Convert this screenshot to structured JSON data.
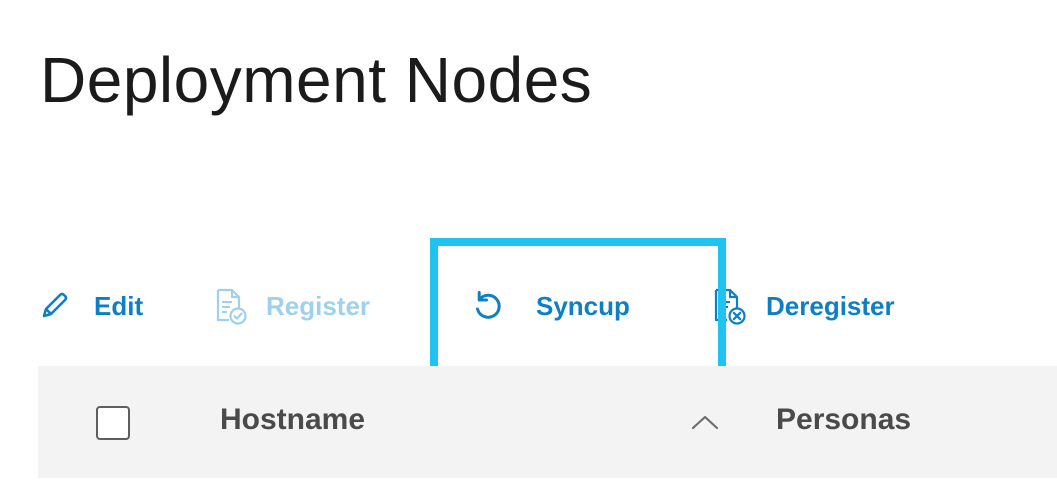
{
  "page": {
    "title": "Deployment Nodes"
  },
  "toolbar": {
    "edit": {
      "label": "Edit",
      "icon": "pencil-icon"
    },
    "register": {
      "label": "Register",
      "icon": "register-document-icon",
      "disabled": true
    },
    "syncup": {
      "label": "Syncup",
      "icon": "refresh-icon"
    },
    "deregister": {
      "label": "Deregister",
      "icon": "deregister-document-icon"
    }
  },
  "table": {
    "columns": [
      {
        "label": "Hostname",
        "sort": "ascending"
      },
      {
        "label": "Personas"
      }
    ]
  },
  "colors": {
    "accent": "#0f7fc4",
    "accent_disabled": "#9fd1ec",
    "highlight": "#1ec3f0",
    "header_bg": "#f3f3f3",
    "title_text": "#1b1b1b",
    "header_text": "#4a4a4a"
  }
}
